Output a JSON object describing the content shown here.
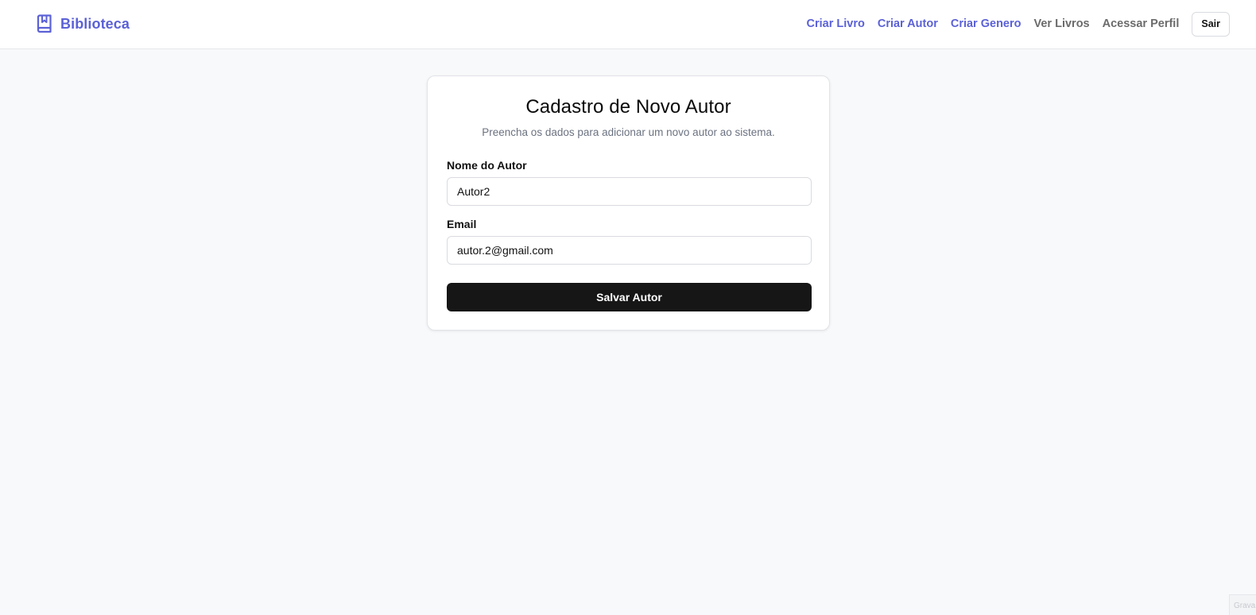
{
  "brand": {
    "name": "Biblioteca",
    "icon": "book-icon",
    "color": "#5b61d6"
  },
  "nav": {
    "links": [
      {
        "label": "Criar Livro",
        "style": "accent"
      },
      {
        "label": "Criar Autor",
        "style": "accent"
      },
      {
        "label": "Criar Genero",
        "style": "accent"
      },
      {
        "label": "Ver Livros",
        "style": "muted"
      },
      {
        "label": "Acessar Perfil",
        "style": "muted"
      }
    ],
    "logout_label": "Sair"
  },
  "form": {
    "title": "Cadastro de Novo Autor",
    "subtitle": "Preencha os dados para adicionar um novo autor ao sistema.",
    "name_label": "Nome do Autor",
    "name_value": "Autor2",
    "email_label": "Email",
    "email_value": "autor.2@gmail.com",
    "submit_label": "Salvar Autor"
  },
  "corner_text": "Grava",
  "colors": {
    "accent": "#5b61d6",
    "button_dark": "#161616",
    "page_background": "#f8f9fb"
  }
}
